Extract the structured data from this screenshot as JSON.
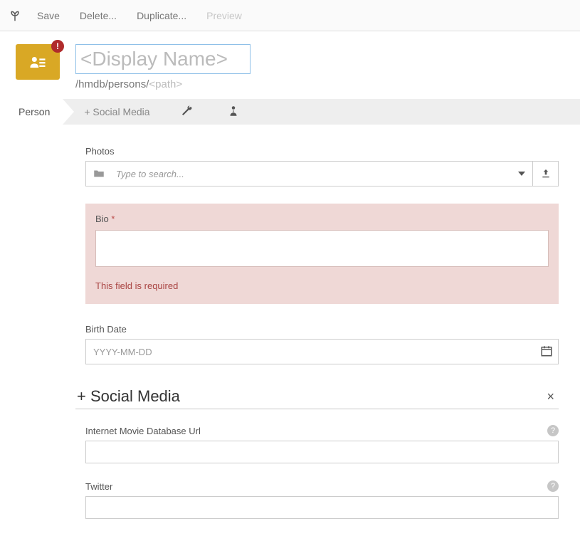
{
  "toolbar": {
    "save": "Save",
    "delete": "Delete...",
    "duplicate": "Duplicate...",
    "preview": "Preview"
  },
  "header": {
    "display_name_placeholder": "<Display Name>",
    "path_prefix": "/hmdb/persons/",
    "path_placeholder": "<path>",
    "badge": "!"
  },
  "tabs": {
    "person": "Person",
    "social": "+ Social Media"
  },
  "form": {
    "photos": {
      "label": "Photos",
      "placeholder": "Type to search..."
    },
    "bio": {
      "label": "Bio",
      "required_mark": "*",
      "error": "This field is required"
    },
    "birth": {
      "label": "Birth Date",
      "placeholder": "YYYY-MM-DD"
    }
  },
  "social": {
    "section_title": "+ Social Media",
    "close": "×",
    "imdb": {
      "label": "Internet Movie Database Url"
    },
    "twitter": {
      "label": "Twitter"
    },
    "help": "?"
  }
}
